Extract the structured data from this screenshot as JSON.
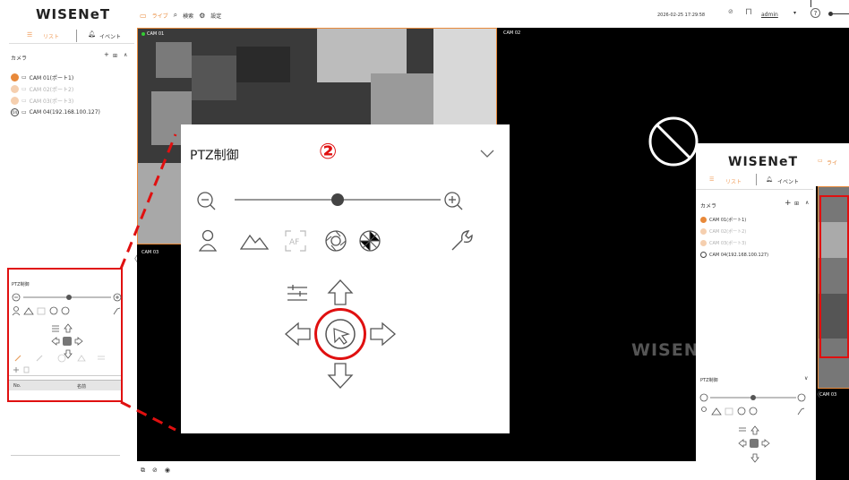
{
  "app": {
    "logo": "WISENeT"
  },
  "topnav": {
    "live": "ライブ",
    "search": "検索",
    "settings": "設定"
  },
  "topbar": {
    "datetime": "2026-02-25 17:29:58",
    "user": "admin"
  },
  "sidebar": {
    "tab_list": "リスト",
    "tab_event": "イベント",
    "camera_header": "カメラ",
    "cameras": [
      {
        "label": "CAM 01(ポート1)"
      },
      {
        "label": "CAM 02(ポート2)"
      },
      {
        "label": "CAM 03(ポート3)"
      },
      {
        "label": "CAM 04(192.168.100.127)"
      }
    ],
    "ptz_title": "PTZ制御",
    "preset_table": {
      "col_no": "No.",
      "col_name": "名前"
    }
  },
  "video": {
    "tiles": [
      "CAM 01",
      "CAM 02",
      "CAM 03"
    ],
    "watermark": "WISEN"
  },
  "callout": {
    "ptz_title": "PTZ制御",
    "number": "②"
  },
  "inset": {
    "logo": "WISENeT",
    "tab_list": "リスト",
    "tab_event": "イベント",
    "camera_header": "カメラ",
    "cameras": [
      {
        "label": "CAM 01(ポート1)"
      },
      {
        "label": "CAM 02(ポート2)"
      },
      {
        "label": "CAM 03(ポート3)"
      },
      {
        "label": "CAM 04(192.168.100.127)"
      }
    ],
    "ptz_title": "PTZ制御",
    "tile": "CAM 03",
    "live_short": "ライ"
  },
  "colors": {
    "accent": "#e8893a",
    "highlight": "#e01010",
    "video_bg": "#000000"
  }
}
